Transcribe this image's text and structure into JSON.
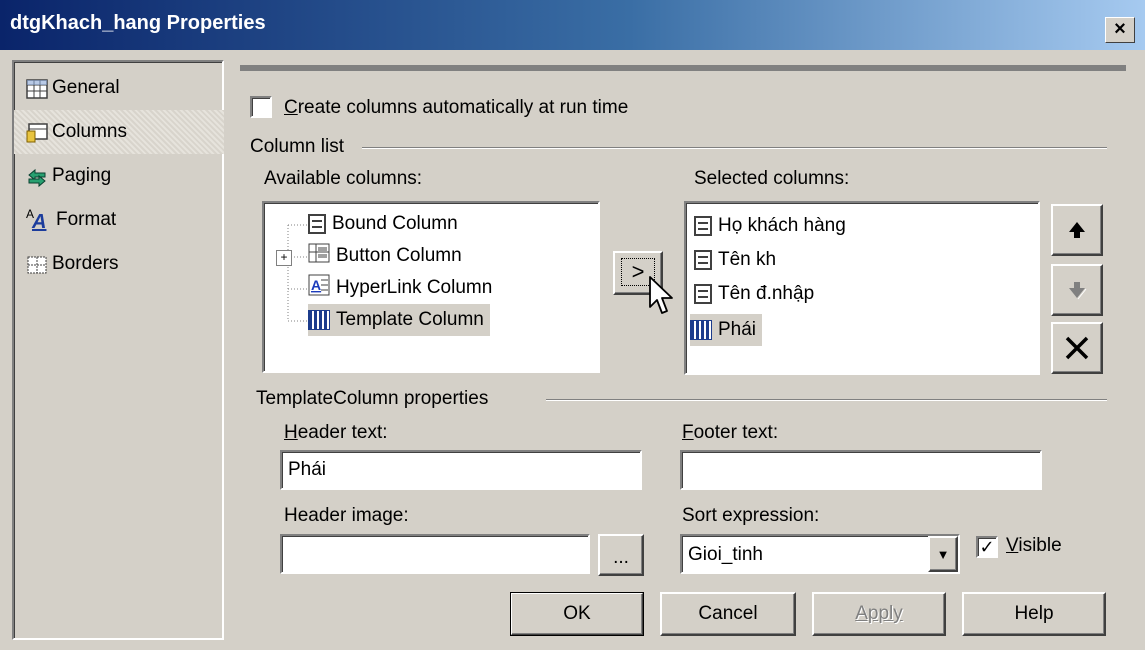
{
  "window": {
    "title": "dtgKhach_hang Properties",
    "close_glyph": "×"
  },
  "nav": {
    "items": [
      {
        "label": "General",
        "icon": "grid-icon"
      },
      {
        "label": "Columns",
        "icon": "columns-icon"
      },
      {
        "label": "Paging",
        "icon": "paging-icon"
      },
      {
        "label": "Format",
        "icon": "format-icon"
      },
      {
        "label": "Borders",
        "icon": "borders-icon"
      }
    ],
    "selected": "Columns",
    "format_glyph": "A"
  },
  "columns_page": {
    "auto_create_label": "Create columns automatically at run time",
    "auto_create_checked": false,
    "column_list_label": "Column list",
    "available_label": "Available columns:",
    "available_items": [
      {
        "label": "Bound Column",
        "expandable": false,
        "icon": "doc-icon"
      },
      {
        "label": "Button Column",
        "expandable": true,
        "icon": "button-column-icon"
      },
      {
        "label": "HyperLink Column",
        "expandable": false,
        "icon": "hyperlink-column-icon"
      },
      {
        "label": "Template Column",
        "expandable": false,
        "icon": "template-column-icon",
        "selected": true
      }
    ],
    "expand_glyph": "+",
    "add_button_label": ">",
    "selected_label": "Selected columns:",
    "selected_items": [
      {
        "label": "Họ khách hàng",
        "icon": "doc-icon"
      },
      {
        "label": "Tên kh",
        "icon": "doc-icon"
      },
      {
        "label": "Tên đ.nhập",
        "icon": "doc-icon"
      },
      {
        "label": "Phái",
        "icon": "template-column-icon",
        "selected": true
      }
    ],
    "move_up_glyph": "🠉",
    "move_down_glyph": "🠋",
    "delete_glyph": "✕"
  },
  "properties": {
    "group_label": "TemplateColumn properties",
    "header_text_label": "Header text:",
    "header_text_value": "Phái",
    "footer_text_label": "Footer text:",
    "footer_text_value": "",
    "header_image_label": "Header image:",
    "header_image_value": "",
    "browse_label": "...",
    "sort_expression_label": "Sort expression:",
    "sort_expression_value": "Gioi_tinh",
    "dropdown_glyph": "▼",
    "visible_label": "Visible",
    "visible_checked": true,
    "check_glyph": "✓"
  },
  "buttons": {
    "ok": "OK",
    "cancel": "Cancel",
    "apply": "Apply",
    "help": "Help"
  }
}
